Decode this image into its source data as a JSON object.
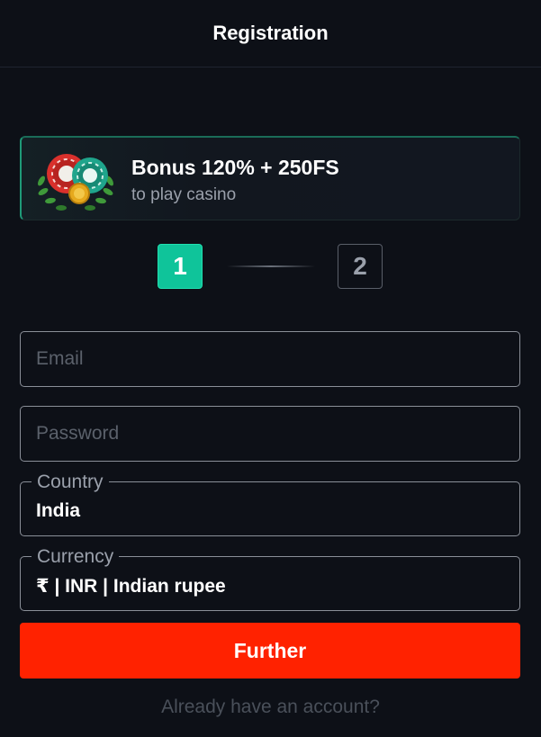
{
  "header": {
    "title": "Registration"
  },
  "bonus": {
    "title": "Bonus 120% + 250FS",
    "subtitle": "to play casino",
    "icon": "casino-chips-laurel-icon"
  },
  "steps": {
    "step1": "1",
    "step2": "2",
    "current": 1
  },
  "form": {
    "email_placeholder": "Email",
    "password_placeholder": "Password",
    "country_label": "Country",
    "country_value": "India",
    "currency_label": "Currency",
    "currency_value": "₹ | INR | Indian rupee"
  },
  "actions": {
    "further_label": "Further",
    "account_link": "Already have an account?"
  },
  "colors": {
    "background": "#0d1017",
    "accent_green": "#0fc49a",
    "button_red": "#ff2200"
  }
}
